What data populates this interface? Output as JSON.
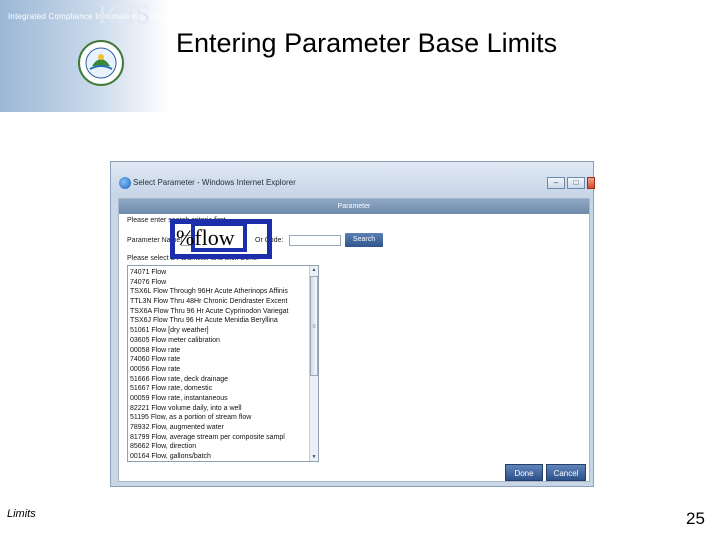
{
  "brand": {
    "subtitle": "Integrated Compliance Information System",
    "logo_text": "ICIS",
    "seal_name": "epa-seal-icon"
  },
  "slide": {
    "title": "Entering Parameter Base Limits",
    "footer_text": "Limits",
    "page_number": "25"
  },
  "dialog": {
    "window_title": "Select Parameter - Windows Internet Explorer",
    "window_buttons": [
      "minimize",
      "maximize",
      "close"
    ],
    "header": "Parameter",
    "instruction_1": "Please enter search criteria first.",
    "param_label": "Parameter Name:",
    "param_value": "",
    "or_code_label": "Or Code:",
    "code_value": "",
    "search_label": "Search",
    "instruction_2": "Please select a Parameter and click Done.",
    "list_items": [
      "74071 Flow",
      "74076 Flow",
      "TSX6L Flow Through 96Hr Acute Atherinops Affinis",
      "TTL3N Flow Thru 48Hr Chronic Dendraster Excent",
      "TSX6A Flow Thru 96 Hr Acute Cyprinodon Variegat",
      "TSX6J Flow Thru 96 Hr Acute Menidia Beryllina",
      "51061 Flow [dry weather]",
      "03605 Flow meter calibration",
      "00058 Flow rate",
      "74060 Flow rate",
      "00056 Flow rate",
      "51666 Flow rate, deck drainage",
      "51667 Flow rate, domestic",
      "00059 Flow rate, instantaneous",
      "82221 Flow volume daily, into a well",
      "51195 Flow, as a portion of stream flow",
      "78932 Flow, augmented water",
      "81799 Flow, average stream per composite sampl",
      "85662 Flow, direction",
      "00164 Flow, gallons/batch"
    ],
    "done_label": "Done",
    "cancel_label": "Cancel"
  },
  "callout": {
    "text": "%flow"
  },
  "colors": {
    "callout_border": "#1c2faa",
    "header_blue": "#7891b0",
    "button_blue": "#3f659d"
  }
}
